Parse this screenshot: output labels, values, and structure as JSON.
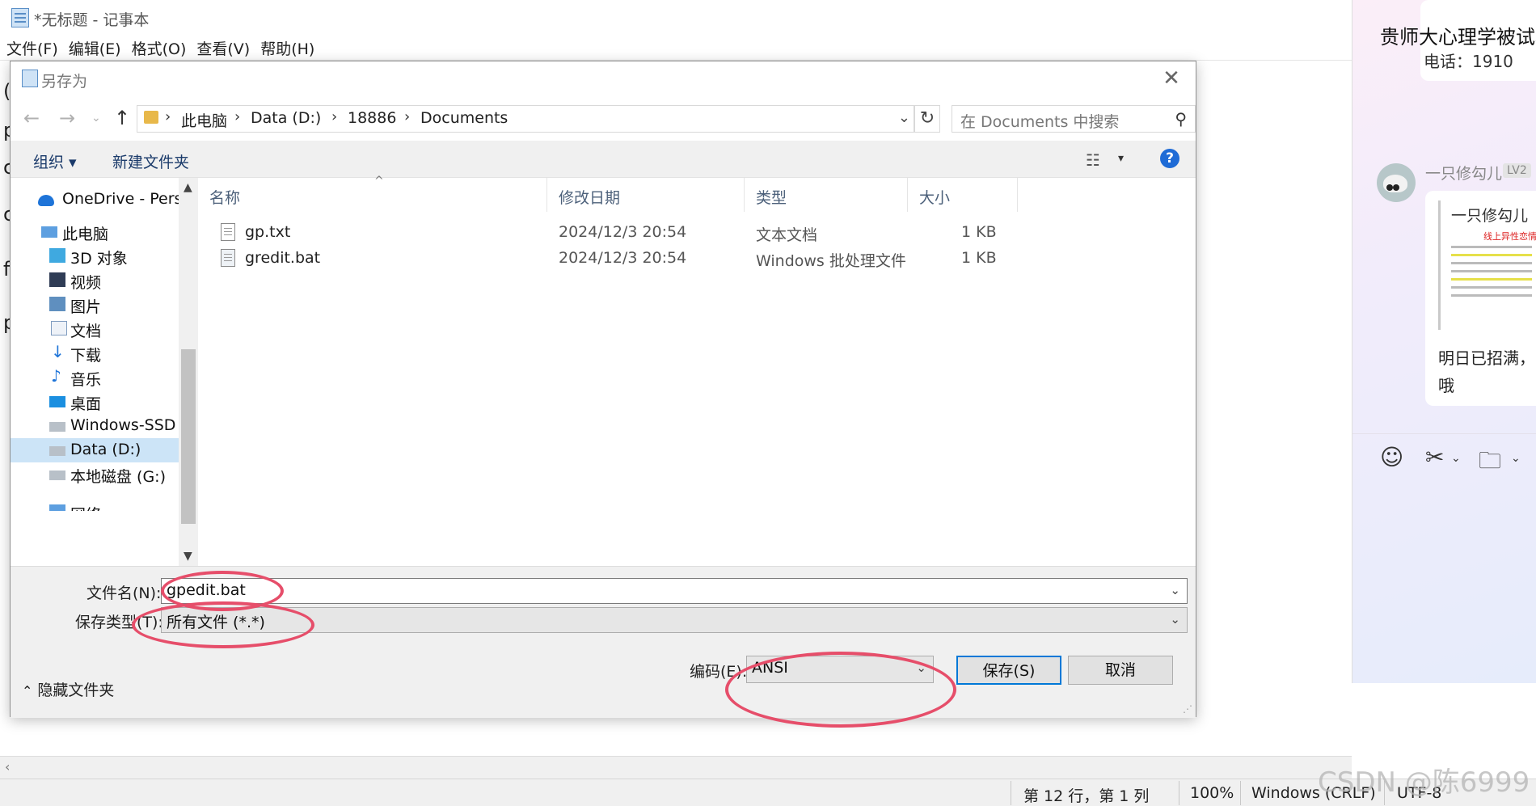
{
  "notepad": {
    "title": "*无标题 - 记事本",
    "menu": [
      "文件(F)",
      "编辑(E)",
      "格式(O)",
      "查看(V)",
      "帮助(H)"
    ],
    "left_chars": [
      "(",
      "p",
      "c",
      "c",
      "f",
      "p"
    ],
    "status": {
      "position": "第 12 行，第 1 列",
      "zoom": "100%",
      "line_ending": "Windows (CRLF)",
      "encoding": "UTF-8"
    }
  },
  "chat": {
    "title": "贵师大心理学被试群",
    "cut_line": "电话：1910",
    "nickname": "一只修勾儿",
    "level": "LV2",
    "quote_name": "一只修勾儿",
    "quote_red_text": "线上异性恋情侣",
    "message_line1": "明日已招满，",
    "message_line2": "哦"
  },
  "dialog": {
    "title": "另存为",
    "close": "✕",
    "breadcrumbs": [
      "此电脑",
      "Data (D:)",
      "18886",
      "Documents"
    ],
    "search_placeholder": "在 Documents 中搜索",
    "toolbar": {
      "organize": "组织 ▾",
      "new_folder": "新建文件夹"
    },
    "sidebar": [
      {
        "label": "OneDrive - Perso",
        "icon": "cloud-icon"
      },
      {
        "label": "此电脑",
        "icon": "computer-icon"
      },
      {
        "label": "3D 对象",
        "icon": "cube-icon"
      },
      {
        "label": "视频",
        "icon": "video-icon"
      },
      {
        "label": "图片",
        "icon": "picture-icon"
      },
      {
        "label": "文档",
        "icon": "document-icon"
      },
      {
        "label": "下载",
        "icon": "download-icon"
      },
      {
        "label": "音乐",
        "icon": "music-icon"
      },
      {
        "label": "桌面",
        "icon": "desktop-icon"
      },
      {
        "label": "Windows-SSD (",
        "icon": "drive-icon"
      },
      {
        "label": "Data (D:)",
        "icon": "drive-icon",
        "selected": true
      },
      {
        "label": "本地磁盘 (G:)",
        "icon": "drive-icon"
      },
      {
        "label": "网络",
        "icon": "network-icon"
      }
    ],
    "columns": [
      "名称",
      "修改日期",
      "类型",
      "大小"
    ],
    "files": [
      {
        "name": "gp.txt",
        "modified": "2024/12/3 20:54",
        "type": "文本文档",
        "size": "1 KB"
      },
      {
        "name": "gredit.bat",
        "modified": "2024/12/3 20:54",
        "type": "Windows 批处理文件",
        "size": "1 KB"
      }
    ],
    "filename_label": "文件名(N):",
    "filename_value": "gpedit.bat",
    "filetype_label": "保存类型(T):",
    "filetype_value": "所有文件  (*.*)",
    "encoding_label": "编码(E):",
    "encoding_value": "ANSI",
    "save_button": "保存(S)",
    "cancel_button": "取消",
    "hide_folders": "隐藏文件夹"
  },
  "annotation_color": "#e64e6a",
  "watermark": "CSDN @陈6999"
}
